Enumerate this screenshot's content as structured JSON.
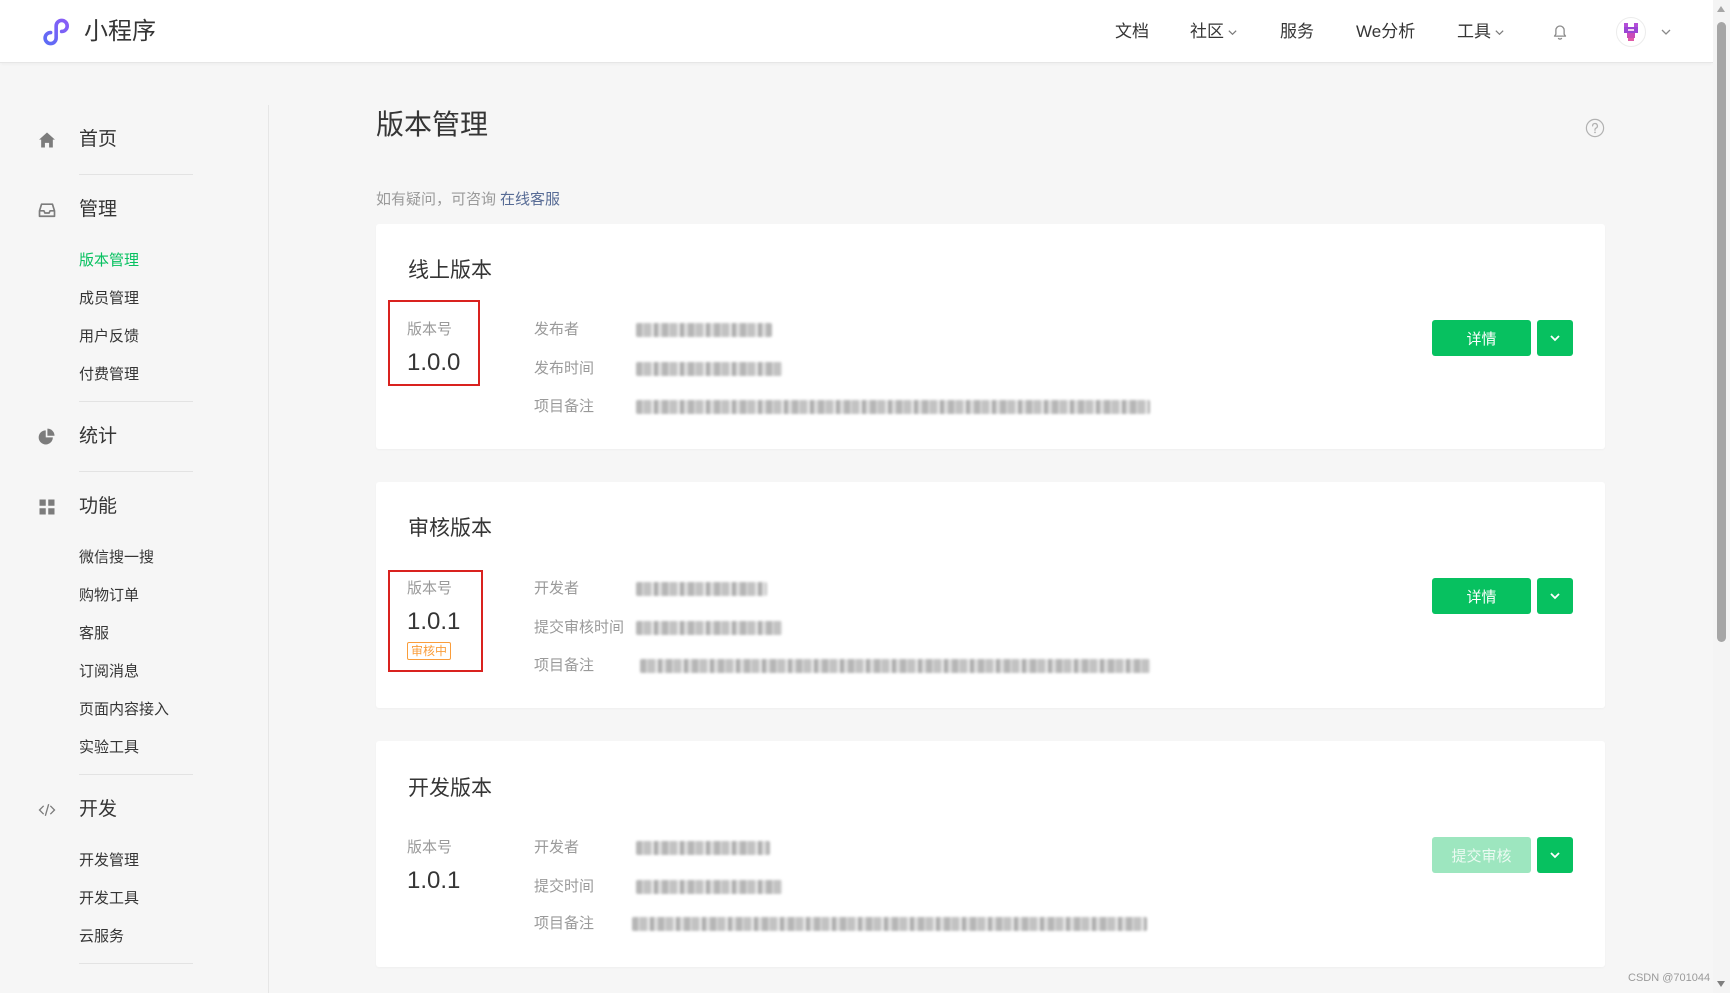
{
  "header": {
    "logo_icon": "mini-program-logo-icon",
    "app_title": "小程序",
    "nav": [
      {
        "label": "文档"
      },
      {
        "label": "社区",
        "dropdown_icon": "chevron-down-icon"
      },
      {
        "label": "服务"
      },
      {
        "label": "We分析"
      },
      {
        "label": "工具",
        "dropdown_icon": "chevron-down-icon"
      }
    ],
    "notification_icon": "bell-icon",
    "avatar_icon": "avatar",
    "account_menu_icon": "chevron-down-icon"
  },
  "sidebar": {
    "groups": [
      {
        "label": "首页",
        "icon": "home-icon",
        "items": []
      },
      {
        "label": "管理",
        "icon": "inbox-icon",
        "items": [
          {
            "label": "版本管理",
            "active": true
          },
          {
            "label": "成员管理"
          },
          {
            "label": "用户反馈"
          },
          {
            "label": "付费管理"
          }
        ]
      },
      {
        "label": "统计",
        "icon": "pie-chart-icon",
        "items": []
      },
      {
        "label": "功能",
        "icon": "grid-icon",
        "items": [
          {
            "label": "微信搜一搜"
          },
          {
            "label": "购物订单"
          },
          {
            "label": "客服"
          },
          {
            "label": "订阅消息"
          },
          {
            "label": "页面内容接入"
          },
          {
            "label": "实验工具"
          }
        ]
      },
      {
        "label": "开发",
        "icon": "code-icon",
        "items": [
          {
            "label": "开发管理"
          },
          {
            "label": "开发工具"
          },
          {
            "label": "云服务"
          }
        ]
      }
    ]
  },
  "main": {
    "title": "版本管理",
    "help_icon": "help-icon",
    "notice": {
      "text": "如有疑问，可咨询",
      "link": "在线客服"
    },
    "cards": [
      {
        "title": "线上版本",
        "version_label": "版本号",
        "version": "1.0.0",
        "fields": [
          {
            "label": "发布者"
          },
          {
            "label": "发布时间"
          },
          {
            "label": "项目备注"
          }
        ],
        "primary_button": {
          "label": "详情",
          "enabled": true
        },
        "more_icon": "chevron-down-icon"
      },
      {
        "title": "审核版本",
        "version_label": "版本号",
        "version": "1.0.1",
        "status_badge": "审核中",
        "fields": [
          {
            "label": "开发者"
          },
          {
            "label": "提交审核时间"
          },
          {
            "label": "项目备注"
          }
        ],
        "primary_button": {
          "label": "详情",
          "enabled": true
        },
        "more_icon": "chevron-down-icon"
      },
      {
        "title": "开发版本",
        "version_label": "版本号",
        "version": "1.0.1",
        "fields": [
          {
            "label": "开发者"
          },
          {
            "label": "提交时间"
          },
          {
            "label": "项目备注"
          }
        ],
        "primary_button": {
          "label": "提交审核",
          "enabled": false
        },
        "more_icon": "chevron-down-icon"
      }
    ]
  },
  "colors": {
    "brand_green": "#07c160",
    "disabled_green": "#9de6bf",
    "link": "#576b95",
    "highlight_box": "#d9221f",
    "badge_orange": "#fa9d3b",
    "logo": "#6366f1"
  },
  "watermark": "CSDN @701044"
}
